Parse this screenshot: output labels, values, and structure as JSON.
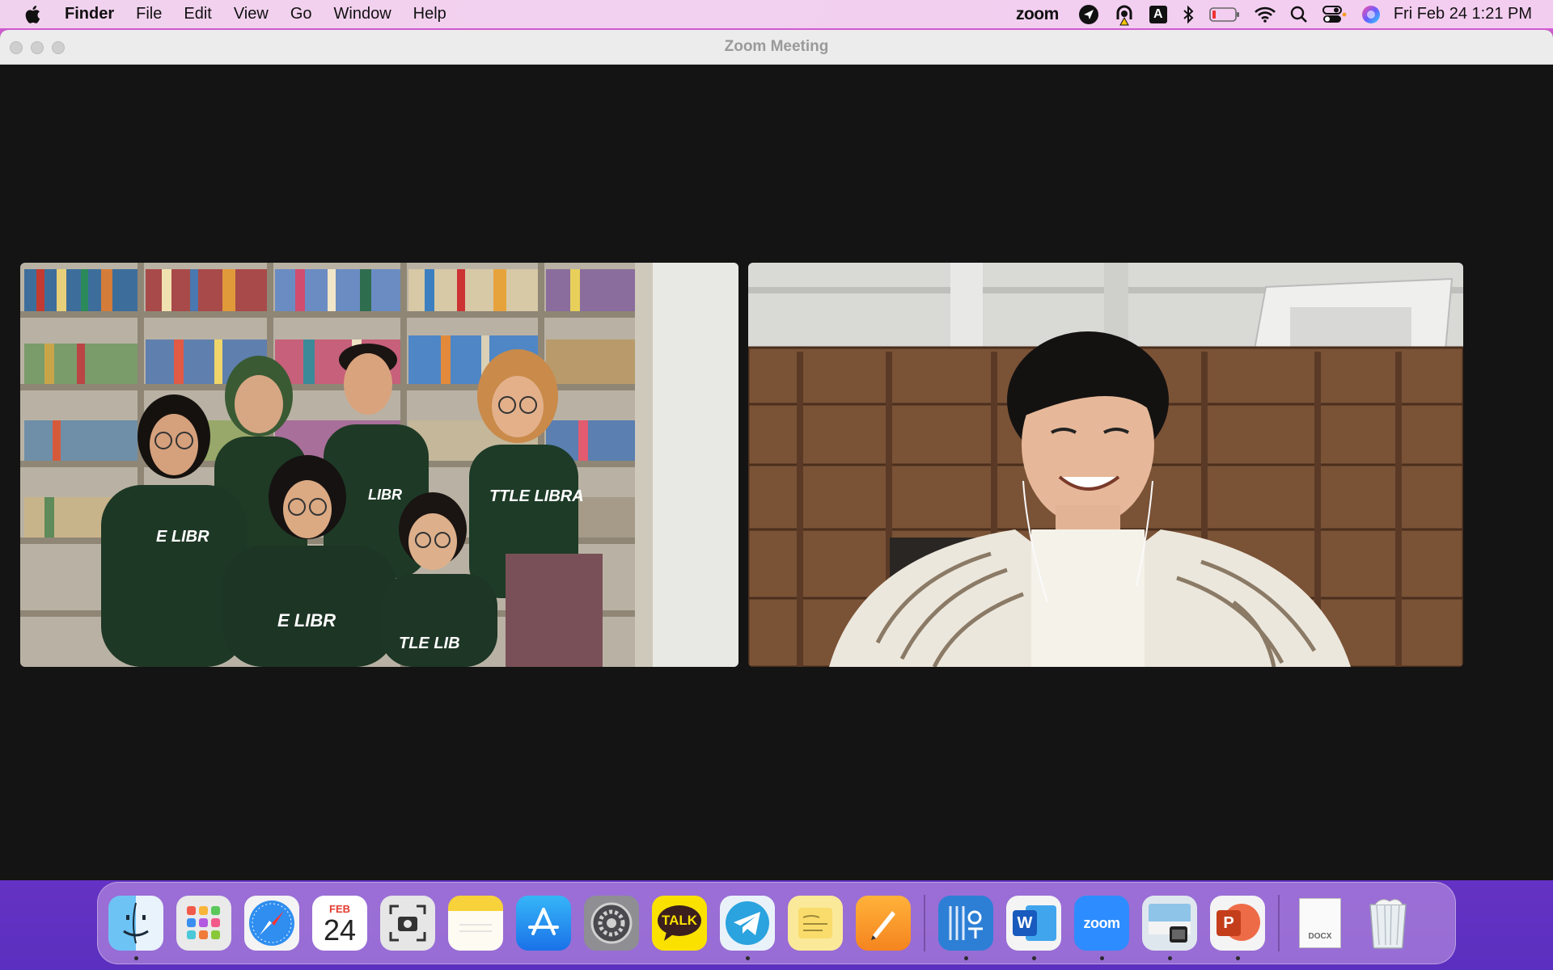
{
  "menubar": {
    "app_name": "Finder",
    "menus": [
      "File",
      "Edit",
      "View",
      "Go",
      "Window",
      "Help"
    ],
    "zoom_label": "zoom",
    "keyboard_label": "A",
    "clock": "Fri Feb 24  1:21 PM"
  },
  "window": {
    "title": "Zoom Meeting"
  },
  "video_tiles": {
    "left_shirt_text": "TTLE LIBRA",
    "left_shirt_text_2": "E LIBR",
    "left_shirt_text_3": "E LIBR",
    "left_shirt_text_4": "TLE LIB",
    "left_shirt_text_5": "LIBR"
  },
  "dock": {
    "calendar_month": "FEB",
    "calendar_day": "24",
    "kakao_label": "TALK",
    "word_label": "W",
    "zoom_label": "zoom",
    "ppt_label": "P",
    "docx_label": "DOCX",
    "items": [
      {
        "name": "Finder",
        "running": true
      },
      {
        "name": "Launchpad",
        "running": false
      },
      {
        "name": "Safari",
        "running": false
      },
      {
        "name": "Calendar",
        "running": false
      },
      {
        "name": "Screenshot",
        "running": false
      },
      {
        "name": "Notes",
        "running": false
      },
      {
        "name": "App Store",
        "running": false
      },
      {
        "name": "System Preferences",
        "running": false
      },
      {
        "name": "KakaoTalk",
        "running": false
      },
      {
        "name": "Telegram",
        "running": true
      },
      {
        "name": "Stickies",
        "running": false
      },
      {
        "name": "Pages",
        "running": false
      },
      {
        "name": "Hangul",
        "running": true
      },
      {
        "name": "Word",
        "running": true
      },
      {
        "name": "Zoom",
        "running": true
      },
      {
        "name": "Preview",
        "running": true
      },
      {
        "name": "PowerPoint",
        "running": true
      },
      {
        "name": "Document",
        "running": false
      },
      {
        "name": "Trash",
        "running": false
      }
    ]
  },
  "colors": {
    "zoom_blue": "#2d8cff",
    "kakao_yellow": "#fae100",
    "ppt_red": "#d24726",
    "word_blue": "#2b579a"
  }
}
